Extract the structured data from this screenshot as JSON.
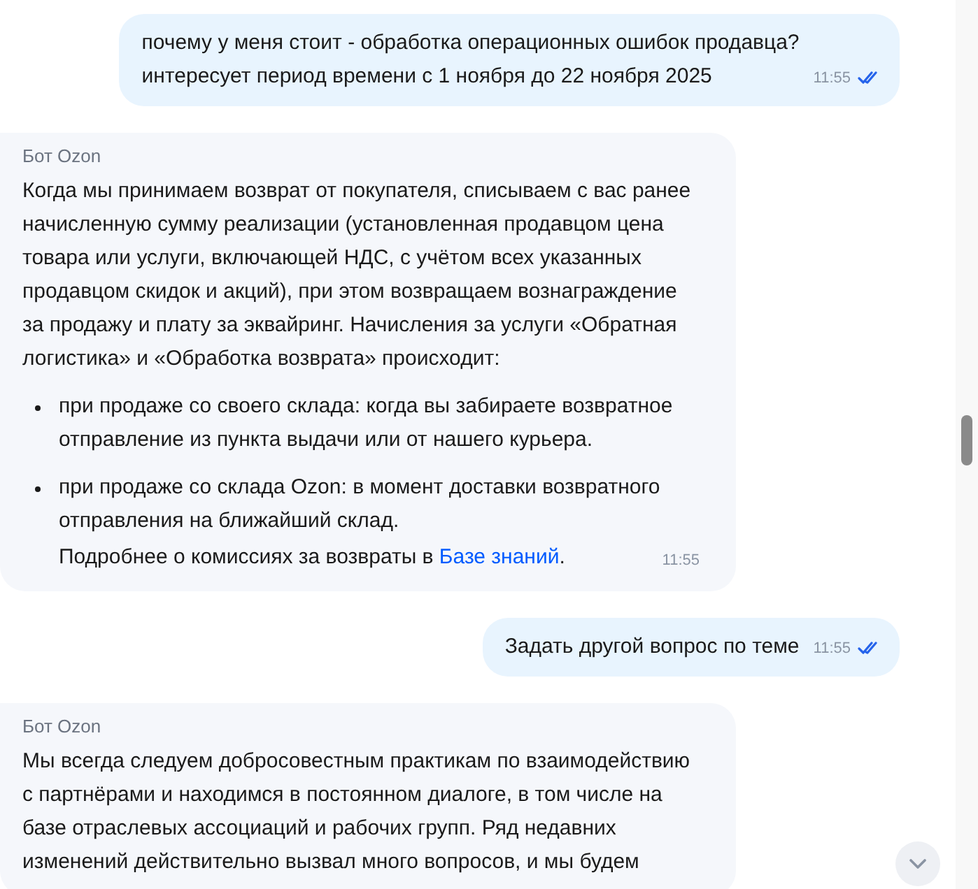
{
  "messages": [
    {
      "kind": "user",
      "text": "почему у меня стоит - обработка операционных ошибок продавца?\nинтересует период времени с 1 ноября до 22 ноября 2025",
      "time": "11:55",
      "read": true
    },
    {
      "kind": "bot",
      "sender": "Бот Ozon",
      "time": "11:55",
      "blocks": [
        {
          "kind": "paragraph",
          "text": "Когда мы принимаем возврат от покупателя, списываем с вас ранее начисленную сумму реализации (установленная продавцом цена товара или услуги, включающей НДС, с учётом всех указанных продавцом скидок и акций), при этом возвращаем вознаграждение за продажу и плату за эквайринг. Начисления за услуги «Обратная логистика» и «Обработка возврата» происходит:"
        },
        {
          "kind": "bullet",
          "text": "при продаже со своего склада: когда вы забираете возвратное отправление из пункта выдачи или от нашего курьера."
        },
        {
          "kind": "bullet",
          "text": "при продаже со склада Ozon: в момент доставки возвратного отправления на ближайший склад.",
          "extra": [
            {
              "kind": "text",
              "text": "Подробнее о комиссиях за возвраты в "
            },
            {
              "kind": "link",
              "text": "Базе знаний"
            },
            {
              "kind": "text",
              "text": "."
            }
          ]
        }
      ]
    },
    {
      "kind": "user",
      "text": "Задать другой вопрос по теме",
      "time": "11:55",
      "read": true
    },
    {
      "kind": "bot",
      "sender": "Бот Ozon",
      "blocks": [
        {
          "kind": "paragraph",
          "text": "Мы всегда следуем добросовестным практикам по взаимодействию с партнёрами и находимся в постоянном диалоге, в том числе на базе отраслевых ассоциаций и рабочих групп. Ряд недавних изменений действительно вызвал много вопросов, и мы будем"
        }
      ]
    }
  ]
}
